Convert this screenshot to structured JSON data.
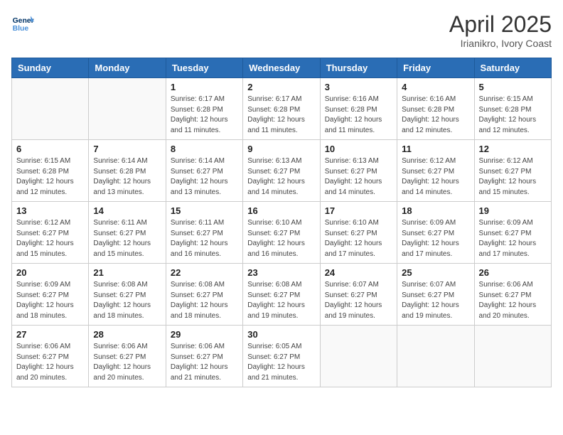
{
  "header": {
    "logo_line1": "General",
    "logo_line2": "Blue",
    "month": "April 2025",
    "location": "Irianikro, Ivory Coast"
  },
  "weekdays": [
    "Sunday",
    "Monday",
    "Tuesday",
    "Wednesday",
    "Thursday",
    "Friday",
    "Saturday"
  ],
  "weeks": [
    [
      {
        "day": "",
        "info": ""
      },
      {
        "day": "",
        "info": ""
      },
      {
        "day": "1",
        "info": "Sunrise: 6:17 AM\nSunset: 6:28 PM\nDaylight: 12 hours and 11 minutes."
      },
      {
        "day": "2",
        "info": "Sunrise: 6:17 AM\nSunset: 6:28 PM\nDaylight: 12 hours and 11 minutes."
      },
      {
        "day": "3",
        "info": "Sunrise: 6:16 AM\nSunset: 6:28 PM\nDaylight: 12 hours and 11 minutes."
      },
      {
        "day": "4",
        "info": "Sunrise: 6:16 AM\nSunset: 6:28 PM\nDaylight: 12 hours and 12 minutes."
      },
      {
        "day": "5",
        "info": "Sunrise: 6:15 AM\nSunset: 6:28 PM\nDaylight: 12 hours and 12 minutes."
      }
    ],
    [
      {
        "day": "6",
        "info": "Sunrise: 6:15 AM\nSunset: 6:28 PM\nDaylight: 12 hours and 12 minutes."
      },
      {
        "day": "7",
        "info": "Sunrise: 6:14 AM\nSunset: 6:28 PM\nDaylight: 12 hours and 13 minutes."
      },
      {
        "day": "8",
        "info": "Sunrise: 6:14 AM\nSunset: 6:27 PM\nDaylight: 12 hours and 13 minutes."
      },
      {
        "day": "9",
        "info": "Sunrise: 6:13 AM\nSunset: 6:27 PM\nDaylight: 12 hours and 14 minutes."
      },
      {
        "day": "10",
        "info": "Sunrise: 6:13 AM\nSunset: 6:27 PM\nDaylight: 12 hours and 14 minutes."
      },
      {
        "day": "11",
        "info": "Sunrise: 6:12 AM\nSunset: 6:27 PM\nDaylight: 12 hours and 14 minutes."
      },
      {
        "day": "12",
        "info": "Sunrise: 6:12 AM\nSunset: 6:27 PM\nDaylight: 12 hours and 15 minutes."
      }
    ],
    [
      {
        "day": "13",
        "info": "Sunrise: 6:12 AM\nSunset: 6:27 PM\nDaylight: 12 hours and 15 minutes."
      },
      {
        "day": "14",
        "info": "Sunrise: 6:11 AM\nSunset: 6:27 PM\nDaylight: 12 hours and 15 minutes."
      },
      {
        "day": "15",
        "info": "Sunrise: 6:11 AM\nSunset: 6:27 PM\nDaylight: 12 hours and 16 minutes."
      },
      {
        "day": "16",
        "info": "Sunrise: 6:10 AM\nSunset: 6:27 PM\nDaylight: 12 hours and 16 minutes."
      },
      {
        "day": "17",
        "info": "Sunrise: 6:10 AM\nSunset: 6:27 PM\nDaylight: 12 hours and 17 minutes."
      },
      {
        "day": "18",
        "info": "Sunrise: 6:09 AM\nSunset: 6:27 PM\nDaylight: 12 hours and 17 minutes."
      },
      {
        "day": "19",
        "info": "Sunrise: 6:09 AM\nSunset: 6:27 PM\nDaylight: 12 hours and 17 minutes."
      }
    ],
    [
      {
        "day": "20",
        "info": "Sunrise: 6:09 AM\nSunset: 6:27 PM\nDaylight: 12 hours and 18 minutes."
      },
      {
        "day": "21",
        "info": "Sunrise: 6:08 AM\nSunset: 6:27 PM\nDaylight: 12 hours and 18 minutes."
      },
      {
        "day": "22",
        "info": "Sunrise: 6:08 AM\nSunset: 6:27 PM\nDaylight: 12 hours and 18 minutes."
      },
      {
        "day": "23",
        "info": "Sunrise: 6:08 AM\nSunset: 6:27 PM\nDaylight: 12 hours and 19 minutes."
      },
      {
        "day": "24",
        "info": "Sunrise: 6:07 AM\nSunset: 6:27 PM\nDaylight: 12 hours and 19 minutes."
      },
      {
        "day": "25",
        "info": "Sunrise: 6:07 AM\nSunset: 6:27 PM\nDaylight: 12 hours and 19 minutes."
      },
      {
        "day": "26",
        "info": "Sunrise: 6:06 AM\nSunset: 6:27 PM\nDaylight: 12 hours and 20 minutes."
      }
    ],
    [
      {
        "day": "27",
        "info": "Sunrise: 6:06 AM\nSunset: 6:27 PM\nDaylight: 12 hours and 20 minutes."
      },
      {
        "day": "28",
        "info": "Sunrise: 6:06 AM\nSunset: 6:27 PM\nDaylight: 12 hours and 20 minutes."
      },
      {
        "day": "29",
        "info": "Sunrise: 6:06 AM\nSunset: 6:27 PM\nDaylight: 12 hours and 21 minutes."
      },
      {
        "day": "30",
        "info": "Sunrise: 6:05 AM\nSunset: 6:27 PM\nDaylight: 12 hours and 21 minutes."
      },
      {
        "day": "",
        "info": ""
      },
      {
        "day": "",
        "info": ""
      },
      {
        "day": "",
        "info": ""
      }
    ]
  ]
}
